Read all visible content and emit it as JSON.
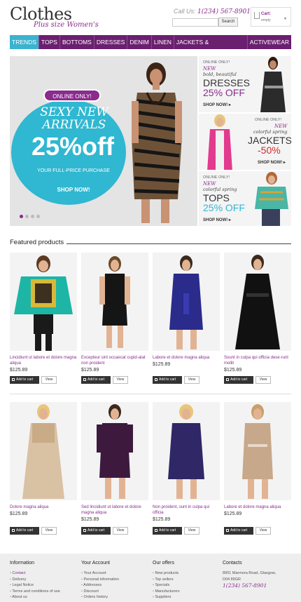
{
  "header": {
    "logo_title": "Clothes",
    "logo_subtitle": "Plus size Women's",
    "call_label": "Call Us:",
    "phone": "1(234) 567-8901",
    "search_button": "Search",
    "cart_title": "Cart:",
    "cart_status": "empty"
  },
  "nav": {
    "items": [
      "TRENDS",
      "TOPS",
      "BOTTOMS",
      "DRESSES",
      "DENIM",
      "LINEN",
      "JACKETS & OUTERWEAR",
      "ACTIVEWEAR"
    ],
    "active_index": 0
  },
  "slider": {
    "badge": "ONLINE ONLY!",
    "line1": "SEXY NEW",
    "line2": "ARRIVALS",
    "discount": "25%off",
    "description": "YOUR FULL-PRICE PURCHASE",
    "shop_now": "SHOP NOW!",
    "slide_count": 4,
    "active_slide": 0
  },
  "side_banners": [
    {
      "online": "ONLINE ONLY!",
      "new": "NEW",
      "desc": "bold, beautiful",
      "category": "DRESSES",
      "discount": "25% OFF",
      "shop": "SHOP NOW! ▸"
    },
    {
      "online": "ONLINE ONLY!",
      "new": "NEW",
      "desc": "colorful spring",
      "category": "JACKETS",
      "discount": "-50%",
      "shop": "SHOP NOW! ▸"
    },
    {
      "online": "ONLINE ONLY!",
      "new": "NEW",
      "desc": "colorful spring",
      "category": "TOPS",
      "discount": "25% OFF",
      "shop": "SHOP NOW! ▸"
    }
  ],
  "featured": {
    "title": "Featured products",
    "add_to_cart": "Add to cart",
    "view": "View",
    "products": [
      {
        "name": "Lincidiunt ut labore et dolore magna aliqua",
        "price": "$125.89"
      },
      {
        "name": "Excepteur sint occaecat cupid-atat non proident",
        "price": "$125.89"
      },
      {
        "name": "Labore et dolore magna aliqua",
        "price": "$125.89"
      },
      {
        "name": "Sount in culpa qui officia dese-runt mollit",
        "price": "$125.89"
      },
      {
        "name": "Dolore magna aliqua",
        "price": "$125.89"
      },
      {
        "name": "Sed lincidiunt ut labore et dolore magna aliqua",
        "price": "$125.89"
      },
      {
        "name": "Non proident, sunt in culpa qui officia",
        "price": "$125.89"
      },
      {
        "name": "Labore et dolore magna aliqua",
        "price": "$125.89"
      }
    ]
  },
  "footer": {
    "information": {
      "title": "Information",
      "links": [
        "Contact",
        "Delivery",
        "Legal Notice",
        "Terms and conditions of use",
        "About us"
      ]
    },
    "account": {
      "title": "Your Account",
      "links": [
        "Your Account",
        "Personal information",
        "Addresses",
        "Discount",
        "Orders history"
      ]
    },
    "offers": {
      "title": "Our offers",
      "links": [
        "New products",
        "Top sellers",
        "Specials",
        "Manufacturers",
        "Suppliers"
      ]
    },
    "contacts": {
      "title": "Contacts",
      "address": "8901 Marmora Road, Glasgow,",
      "address2": "D04 89GR",
      "phone": "1(234) 567-8901"
    }
  },
  "colors": {
    "purple": "#6b1f6f",
    "accent": "#8a2b8e",
    "teal": "#3bb3cf"
  }
}
